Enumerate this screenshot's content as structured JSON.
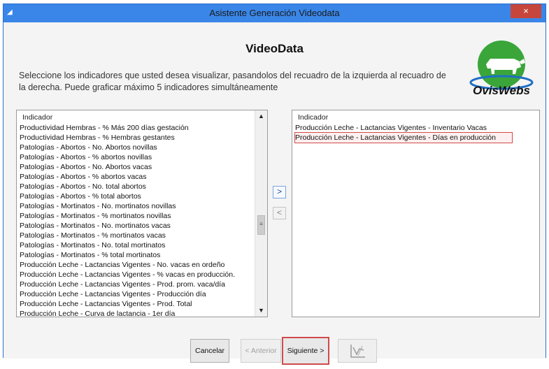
{
  "window": {
    "title": "Asistente Generación Videodata",
    "close_glyph": "×"
  },
  "heading": "VideoData",
  "instructions": "Seleccione los indicadores que usted desea visualizar, pasandolos del recuadro de la izquierda al recuadro de la derecha. Puede graficar máximo 5 indicadores simultáneamente",
  "logo": {
    "text": "OvisWebs",
    "colors": {
      "green": "#3aa63a",
      "blue": "#1f6fc4",
      "dark": "#111111"
    }
  },
  "left_list": {
    "header": "Indicador",
    "items": [
      "Productividad Hembras - % Más 200 días gestación",
      "Productividad Hembras - % Hembras gestantes",
      "Patologías - Abortos - No. Abortos novillas",
      "Patologías - Abortos - % abortos novillas",
      "Patologías - Abortos - No. Abortos vacas",
      "Patologías - Abortos - % abortos vacas",
      "Patologías - Abortos - No. total abortos",
      "Patologías - Abortos - % total abortos",
      "Patologías - Mortinatos - No. mortinatos novillas",
      "Patologías - Mortinatos - % mortinatos novillas",
      "Patologías - Mortinatos - No. mortinatos vacas",
      "Patologías - Mortinatos - % mortinatos vacas",
      "Patologías - Mortinatos - No. total mortinatos",
      "Patologías - Mortinatos - % total mortinatos",
      "Producción Leche - Lactancias Vigentes - No. vacas en ordeño",
      "Producción Leche - Lactancias Vigentes - % vacas en producción.",
      "Producción Leche - Lactancias Vigentes - Prod. prom. vaca/día",
      "Producción Leche - Lactancias Vigentes - Producción día",
      "Producción Leche - Lactancias Vigentes - Prod. Total",
      "Producción Leche - Curva de lactancia - 1er día"
    ]
  },
  "right_list": {
    "header": "Indicador",
    "items": [
      "Producción Leche - Lactancias Vigentes - Inventario Vacas",
      "Producción Leche - Lactancias Vigentes - Días en producción"
    ],
    "selected_index": 1
  },
  "transfer": {
    "right_glyph": ">",
    "left_glyph": "<"
  },
  "buttons": {
    "cancel": "Cancelar",
    "prev": "< Anterior",
    "next": "Siguiente >"
  },
  "scroll": {
    "up_glyph": "▲",
    "down_glyph": "▼",
    "thumb_glyph": "≡"
  },
  "colors": {
    "titlebar": "#3a86e8",
    "close": "#c7463b",
    "highlight": "#d14a4a"
  }
}
